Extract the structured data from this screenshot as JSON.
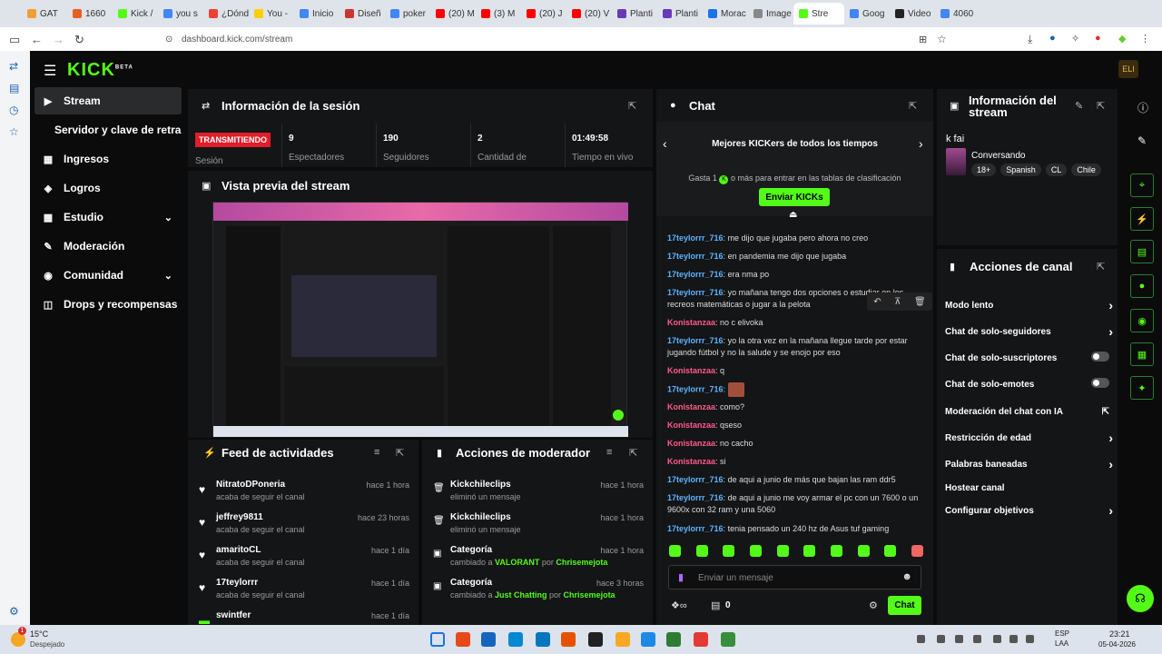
{
  "browser": {
    "tabs": [
      "GAT",
      "1660",
      "Kick /",
      "you s",
      "¿Dónd",
      "You -",
      "Inicio",
      "Diseñ",
      "poker",
      "(20) M",
      "(3) M",
      "(20) J",
      "(20) V",
      "Planti",
      "Planti",
      "Morac",
      "Image",
      "Stre",
      "Goog",
      "Video",
      "4060"
    ],
    "url": "dashboard.kick.com/stream"
  },
  "app": {
    "logo": "KICK",
    "logo_sup": "BETA"
  },
  "sidebar": {
    "items": [
      {
        "label": "Stream",
        "icon": "stream-icon"
      },
      {
        "label": "Servidor y clave de retransm",
        "icon": ""
      },
      {
        "label": "Ingresos",
        "icon": "revenue-icon"
      },
      {
        "label": "Logros",
        "icon": "achievements-icon"
      },
      {
        "label": "Estudio",
        "icon": "studio-icon"
      },
      {
        "label": "Moderación",
        "icon": "moderation-icon"
      },
      {
        "label": "Comunidad",
        "icon": "community-icon"
      },
      {
        "label": "Drops y recompensas",
        "icon": "drops-icon"
      }
    ]
  },
  "session": {
    "title": "Información de la sesión",
    "live_label": "TRANSMITIENDO",
    "session_label": "Sesión",
    "stats": [
      {
        "value": "9",
        "label": "Espectadores"
      },
      {
        "value": "190",
        "label": "Seguidores"
      },
      {
        "value": "2",
        "label": "Cantidad de"
      },
      {
        "value": "01:49:58",
        "label": "Tiempo en vivo"
      }
    ]
  },
  "preview": {
    "title": "Vista previa del stream"
  },
  "feed": {
    "title": "Feed de actividades",
    "rows": [
      {
        "name": "NitratoDPoneria",
        "sub": "acaba de seguir el canal",
        "time": "hace 1 hora"
      },
      {
        "name": "jeffrey9811",
        "sub": "acaba de seguir el canal",
        "time": "hace 23 horas"
      },
      {
        "name": "amaritoCL",
        "sub": "acaba de seguir el canal",
        "time": "hace 1 día"
      },
      {
        "name": "17teylorrr",
        "sub": "acaba de seguir el canal",
        "time": "hace 1 día"
      },
      {
        "name": "swintfer",
        "sub": "",
        "time": "hace 1 día"
      }
    ]
  },
  "modactions": {
    "title": "Acciones de moderador",
    "rows": [
      {
        "name": "Kickchileclips",
        "sub": "eliminó un mensaje",
        "time": "hace 1 hora"
      },
      {
        "name": "Kickchileclips",
        "sub": "eliminó un mensaje",
        "time": "hace 1 hora"
      },
      {
        "name": "Categoría",
        "sub_a": "cambiado a ",
        "sub_b": "VALORANT",
        "sub_c": " por ",
        "sub_d": "Chrisemejota",
        "time": "hace 1 hora"
      },
      {
        "name": "Categoría",
        "sub_a": "cambiado a ",
        "sub_b": "Just Chatting",
        "sub_c": " por ",
        "sub_d": "Chrisemejota",
        "time": "hace 3 horas"
      }
    ]
  },
  "chat": {
    "title": "Chat",
    "leaderboard_title": "Mejores KICKers de todos los tiempos",
    "leaderboard_sub_a": "Gasta 1",
    "leaderboard_sub_b": "o más para entrar en las tablas de clasificación",
    "send_kicks": "Enviar KICKs",
    "messages": [
      {
        "user": "17teylorrr_716",
        "text": "me dijo que jugaba pero ahora no creo",
        "color": "blue"
      },
      {
        "user": "17teylorrr_716",
        "text": "en pandemia me dijo que jugaba",
        "color": "blue"
      },
      {
        "user": "17teylorrr_716",
        "text": "era nma po",
        "color": "blue"
      },
      {
        "user": "17teylorrr_716",
        "text": "yo mañana tengo dos opciones o estudiar en los recreos matemáticas o jugar a la pelota",
        "color": "blue"
      },
      {
        "user": "Konistanzaa",
        "text": "no c elivoka",
        "color": "pink"
      },
      {
        "user": "17teylorrr_716",
        "text": "yo la otra vez en la mañana llegue tarde por estar jugando fútbol y no la salude y se enojo por eso",
        "color": "blue"
      },
      {
        "user": "Konistanzaa",
        "text": "q",
        "color": "pink"
      },
      {
        "user": "17teylorrr_716",
        "text": "",
        "color": "blue"
      },
      {
        "user": "Konistanzaa",
        "text": "como?",
        "color": "pink"
      },
      {
        "user": "Konistanzaa",
        "text": "qseso",
        "color": "pink"
      },
      {
        "user": "Konistanzaa",
        "text": "no cacho",
        "color": "pink"
      },
      {
        "user": "Konistanzaa",
        "text": "si",
        "color": "pink"
      },
      {
        "user": "17teylorrr_716",
        "text": "de aqui a junio de más que bajan las ram ddr5",
        "color": "blue"
      },
      {
        "user": "17teylorrr_716",
        "text": "de aqui a junio me voy armar el pc con un 7600 o un 9600x con 32 ram y una 5060",
        "color": "blue"
      },
      {
        "user": "17teylorrr_716",
        "text": "tenia pensado un 240 hz de Asus tuf gaming",
        "color": "blue"
      }
    ],
    "input_placeholder": "Enviar un mensaje",
    "points": "0",
    "send_label": "Chat"
  },
  "streaminfo": {
    "title": "Información del stream",
    "stream_title": "k fai",
    "category": "Conversando",
    "tags": [
      "18+",
      "Spanish",
      "CL",
      "Chile"
    ]
  },
  "channelactions": {
    "title": "Acciones de canal",
    "items": [
      {
        "label": "Modo lento",
        "kind": "chevron"
      },
      {
        "label": "Chat de solo-seguidores",
        "kind": "chevron"
      },
      {
        "label": "Chat de solo-suscriptores",
        "kind": "toggle"
      },
      {
        "label": "Chat de solo-emotes",
        "kind": "toggle"
      },
      {
        "label": "Moderación del chat con IA",
        "kind": "external"
      },
      {
        "label": "Restricción de edad",
        "kind": "chevron"
      },
      {
        "label": "Palabras baneadas",
        "kind": "chevron"
      },
      {
        "label": "Hostear canal",
        "kind": "none"
      },
      {
        "label": "Configurar objetivos",
        "kind": "chevron"
      }
    ]
  },
  "taskbar": {
    "weather_temp": "15°C",
    "weather_desc": "Despejado",
    "lang": "ESP",
    "lang2": "LAA",
    "time": "23:21",
    "date": "05-04-2026"
  },
  "colors": {
    "accent": "#53fc18",
    "live": "#e01d2a",
    "user_blue": "#5eb3ff",
    "user_pink": "#ff5a8a"
  }
}
